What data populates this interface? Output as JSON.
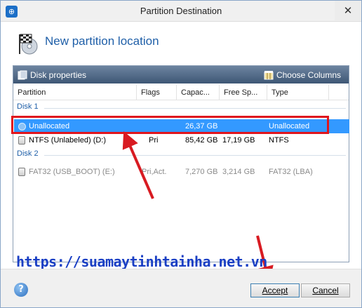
{
  "window": {
    "title": "Partition Destination",
    "close_glyph": "✕",
    "app_icon": "app-icon"
  },
  "header": {
    "title": "New partition location",
    "icon": "checkered-flag-disk-icon"
  },
  "toolbar": {
    "disk_properties": "Disk properties",
    "choose_columns": "Choose Columns"
  },
  "columns": [
    "Partition",
    "Flags",
    "Capac...",
    "Free Sp...",
    "Type"
  ],
  "groups": [
    {
      "label": "Disk 1",
      "rows": [
        {
          "partition": "Unallocated",
          "flags": "",
          "capacity": "26,37 GB",
          "free": "",
          "type": "Unallocated",
          "state": "selected"
        },
        {
          "partition": "NTFS (Unlabeled) (D:)",
          "flags": "Pri",
          "capacity": "85,42 GB",
          "free": "17,19 GB",
          "type": "NTFS",
          "state": "normal"
        }
      ]
    },
    {
      "label": "Disk 2",
      "rows": [
        {
          "partition": "FAT32 (USB_BOOT) (E:)",
          "flags": "Pri,Act.",
          "capacity": "7,270 GB",
          "free": "3,214 GB",
          "type": "FAT32 (LBA)",
          "state": "disabled"
        }
      ]
    }
  ],
  "watermark": "https://suamaytinhtainha.net.vn",
  "buttons": {
    "accept": "Accept",
    "cancel": "Cancel",
    "help": "?"
  },
  "colors": {
    "accent": "#1f5fa8",
    "selection": "#3399ff",
    "highlight": "#e0161d",
    "watermark": "#1a3fc4"
  }
}
